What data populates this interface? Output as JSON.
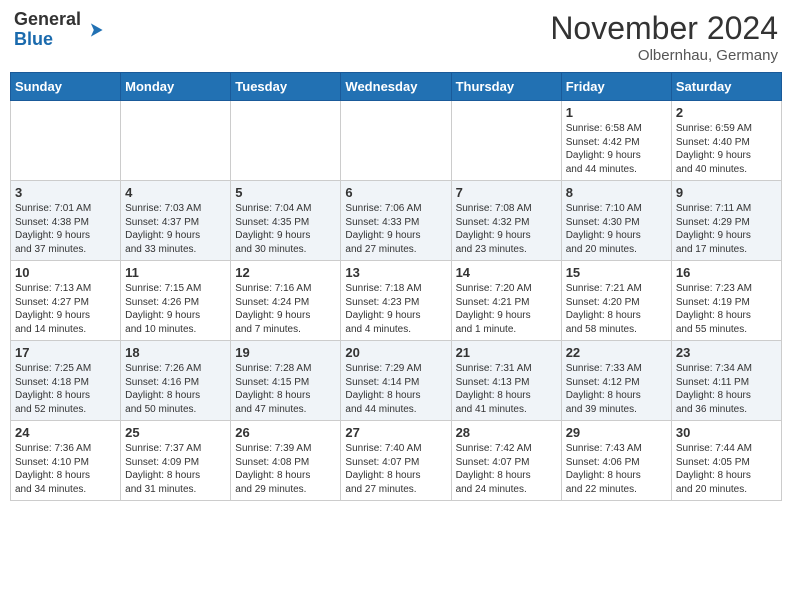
{
  "logo": {
    "line1": "General",
    "line2": "Blue"
  },
  "header": {
    "month_year": "November 2024",
    "location": "Olbernhau, Germany"
  },
  "days_of_week": [
    "Sunday",
    "Monday",
    "Tuesday",
    "Wednesday",
    "Thursday",
    "Friday",
    "Saturday"
  ],
  "weeks": [
    [
      {
        "day": "",
        "info": ""
      },
      {
        "day": "",
        "info": ""
      },
      {
        "day": "",
        "info": ""
      },
      {
        "day": "",
        "info": ""
      },
      {
        "day": "",
        "info": ""
      },
      {
        "day": "1",
        "info": "Sunrise: 6:58 AM\nSunset: 4:42 PM\nDaylight: 9 hours\nand 44 minutes."
      },
      {
        "day": "2",
        "info": "Sunrise: 6:59 AM\nSunset: 4:40 PM\nDaylight: 9 hours\nand 40 minutes."
      }
    ],
    [
      {
        "day": "3",
        "info": "Sunrise: 7:01 AM\nSunset: 4:38 PM\nDaylight: 9 hours\nand 37 minutes."
      },
      {
        "day": "4",
        "info": "Sunrise: 7:03 AM\nSunset: 4:37 PM\nDaylight: 9 hours\nand 33 minutes."
      },
      {
        "day": "5",
        "info": "Sunrise: 7:04 AM\nSunset: 4:35 PM\nDaylight: 9 hours\nand 30 minutes."
      },
      {
        "day": "6",
        "info": "Sunrise: 7:06 AM\nSunset: 4:33 PM\nDaylight: 9 hours\nand 27 minutes."
      },
      {
        "day": "7",
        "info": "Sunrise: 7:08 AM\nSunset: 4:32 PM\nDaylight: 9 hours\nand 23 minutes."
      },
      {
        "day": "8",
        "info": "Sunrise: 7:10 AM\nSunset: 4:30 PM\nDaylight: 9 hours\nand 20 minutes."
      },
      {
        "day": "9",
        "info": "Sunrise: 7:11 AM\nSunset: 4:29 PM\nDaylight: 9 hours\nand 17 minutes."
      }
    ],
    [
      {
        "day": "10",
        "info": "Sunrise: 7:13 AM\nSunset: 4:27 PM\nDaylight: 9 hours\nand 14 minutes."
      },
      {
        "day": "11",
        "info": "Sunrise: 7:15 AM\nSunset: 4:26 PM\nDaylight: 9 hours\nand 10 minutes."
      },
      {
        "day": "12",
        "info": "Sunrise: 7:16 AM\nSunset: 4:24 PM\nDaylight: 9 hours\nand 7 minutes."
      },
      {
        "day": "13",
        "info": "Sunrise: 7:18 AM\nSunset: 4:23 PM\nDaylight: 9 hours\nand 4 minutes."
      },
      {
        "day": "14",
        "info": "Sunrise: 7:20 AM\nSunset: 4:21 PM\nDaylight: 9 hours\nand 1 minute."
      },
      {
        "day": "15",
        "info": "Sunrise: 7:21 AM\nSunset: 4:20 PM\nDaylight: 8 hours\nand 58 minutes."
      },
      {
        "day": "16",
        "info": "Sunrise: 7:23 AM\nSunset: 4:19 PM\nDaylight: 8 hours\nand 55 minutes."
      }
    ],
    [
      {
        "day": "17",
        "info": "Sunrise: 7:25 AM\nSunset: 4:18 PM\nDaylight: 8 hours\nand 52 minutes."
      },
      {
        "day": "18",
        "info": "Sunrise: 7:26 AM\nSunset: 4:16 PM\nDaylight: 8 hours\nand 50 minutes."
      },
      {
        "day": "19",
        "info": "Sunrise: 7:28 AM\nSunset: 4:15 PM\nDaylight: 8 hours\nand 47 minutes."
      },
      {
        "day": "20",
        "info": "Sunrise: 7:29 AM\nSunset: 4:14 PM\nDaylight: 8 hours\nand 44 minutes."
      },
      {
        "day": "21",
        "info": "Sunrise: 7:31 AM\nSunset: 4:13 PM\nDaylight: 8 hours\nand 41 minutes."
      },
      {
        "day": "22",
        "info": "Sunrise: 7:33 AM\nSunset: 4:12 PM\nDaylight: 8 hours\nand 39 minutes."
      },
      {
        "day": "23",
        "info": "Sunrise: 7:34 AM\nSunset: 4:11 PM\nDaylight: 8 hours\nand 36 minutes."
      }
    ],
    [
      {
        "day": "24",
        "info": "Sunrise: 7:36 AM\nSunset: 4:10 PM\nDaylight: 8 hours\nand 34 minutes."
      },
      {
        "day": "25",
        "info": "Sunrise: 7:37 AM\nSunset: 4:09 PM\nDaylight: 8 hours\nand 31 minutes."
      },
      {
        "day": "26",
        "info": "Sunrise: 7:39 AM\nSunset: 4:08 PM\nDaylight: 8 hours\nand 29 minutes."
      },
      {
        "day": "27",
        "info": "Sunrise: 7:40 AM\nSunset: 4:07 PM\nDaylight: 8 hours\nand 27 minutes."
      },
      {
        "day": "28",
        "info": "Sunrise: 7:42 AM\nSunset: 4:07 PM\nDaylight: 8 hours\nand 24 minutes."
      },
      {
        "day": "29",
        "info": "Sunrise: 7:43 AM\nSunset: 4:06 PM\nDaylight: 8 hours\nand 22 minutes."
      },
      {
        "day": "30",
        "info": "Sunrise: 7:44 AM\nSunset: 4:05 PM\nDaylight: 8 hours\nand 20 minutes."
      }
    ]
  ]
}
